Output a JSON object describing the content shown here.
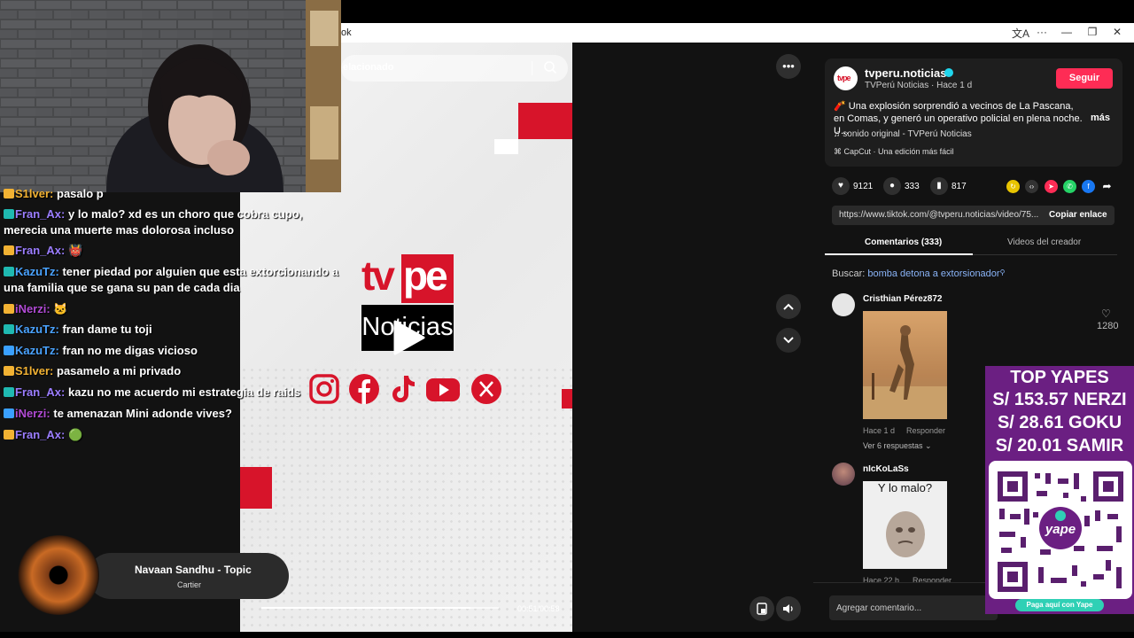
{
  "browser": {
    "tab_title_fragment": "ok",
    "controls": {
      "translate": "文A",
      "menu": "···",
      "minimize": "—",
      "restore": "❐",
      "close": "✕"
    }
  },
  "video": {
    "search_placeholder": "elacionado",
    "brand_tv": "tv",
    "brand_pe": "pe",
    "brand_subtitle": "Noticias",
    "time": "00:51/00:58",
    "progress": 0.88
  },
  "post": {
    "username": "tvperu.noticias",
    "display_name": "TVPerú Noticias",
    "posted": "Hace 1 d",
    "follow_label": "Seguir",
    "caption": "🧨 Una explosión sorprendió a vecinos de La Pascana, en Comas, y generó un operativo policial en plena noche. U...",
    "more_label": "más",
    "sound": "sonido original - TVPerú Noticias",
    "capcut": "CapCut · Una edición más fácil",
    "likes": "9121",
    "comments": "333",
    "saves": "817",
    "url": "https://www.tiktok.com/@tvperu.noticias/video/75...",
    "copy_label": "Copiar enlace"
  },
  "tabs": {
    "comments": "Comentarios (333)",
    "creator_videos": "Videos del creador"
  },
  "search_hint": {
    "prefix": "Buscar:",
    "query": "bomba detona a extorsionador"
  },
  "comments": [
    {
      "author": "Cristhian Pérez872",
      "time": "Hace 1 d",
      "reply": "Responder",
      "replies": "Ver 6 respuestas",
      "likes": "1280"
    },
    {
      "author": "nIcKoLaSs",
      "image_caption": "Y lo malo?",
      "time": "Hace 22 h",
      "reply": "Responder"
    }
  ],
  "add_comment_placeholder": "Agregar comentario...",
  "chat": [
    {
      "user": "S1lver:",
      "msg": "pasalo p",
      "color": "#f2b233"
    },
    {
      "user": "Fran_Ax:",
      "msg": "y lo malo? xd es un choro que cobra cupo,",
      "color": "#9b7dff"
    },
    {
      "user": "",
      "msg": "merecia una muerte mas dolorosa incluso",
      "color": "#ffffff"
    },
    {
      "user": "Fran_Ax:",
      "msg": "👹",
      "color": "#9b7dff"
    },
    {
      "user": "KazuTz:",
      "msg": "tener piedad por alguien que esta extorcionando a",
      "color": "#4aa3ff"
    },
    {
      "user": "",
      "msg": "una familia que se gana su pan de cada dia",
      "color": "#ffffff"
    },
    {
      "user": "iNerzi:",
      "msg": "🐱",
      "color": "#b24bd6"
    },
    {
      "user": "KazuTz:",
      "msg": "fran dame tu toji",
      "color": "#4aa3ff"
    },
    {
      "user": "KazuTz:",
      "msg": "fran no me digas vicioso",
      "color": "#4aa3ff"
    },
    {
      "user": "S1lver:",
      "msg": "pasamelo a mi privado",
      "color": "#f2b233"
    },
    {
      "user": "Fran_Ax:",
      "msg": "kazu no me acuerdo mi estrategia de raids",
      "color": "#9b7dff"
    },
    {
      "user": "iNerzi:",
      "msg": "te amenazan Mini adonde vives?",
      "color": "#b24bd6"
    },
    {
      "user": "Fran_Ax:",
      "msg": "🟢",
      "color": "#9b7dff"
    }
  ],
  "music": {
    "title": "Navaan Sandhu - Topic",
    "artist": "Cartier"
  },
  "yapes": {
    "lines": [
      "TOP YAPES",
      "S/ 153.57 NERZI",
      "S/ 28.61 GOKU",
      "S/ 20.01 SAMIR"
    ],
    "pay_label": "Paga aquí con Yape"
  },
  "colors": {
    "accent": "#fe2c55",
    "brand_red": "#d7142a",
    "yape_purple": "#6b1f82"
  }
}
